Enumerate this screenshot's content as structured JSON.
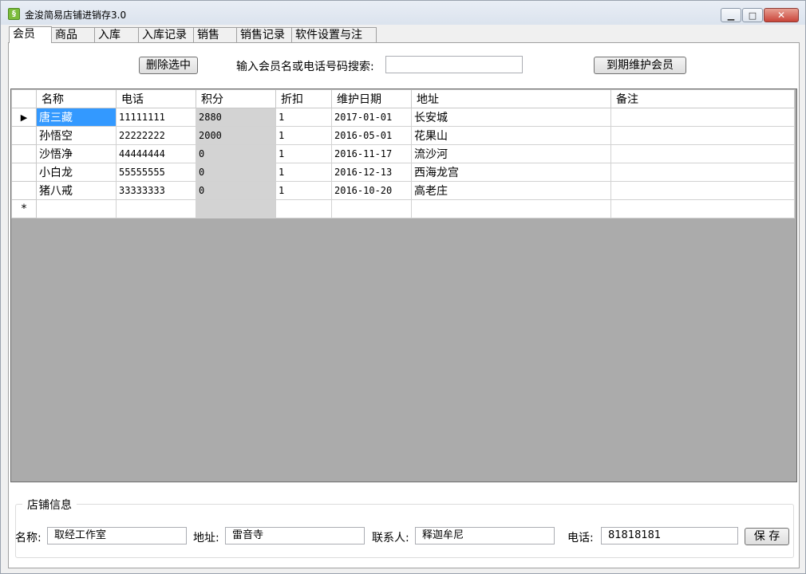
{
  "window": {
    "title": "金浚简易店铺进销存3.0",
    "controls": {
      "minimize": "▁",
      "maximize": "□",
      "close": "✕"
    }
  },
  "tabs": [
    "会员",
    "商品",
    "入库",
    "入库记录",
    "销售",
    "销售记录",
    "软件设置与注册"
  ],
  "toolbar": {
    "delete_label": "删除选中",
    "search_label": "输入会员名或电话号码搜索:",
    "search_value": "",
    "expire_label": "到期维护会员"
  },
  "grid": {
    "columns": [
      "名称",
      "电话",
      "积分",
      "折扣",
      "维护日期",
      "地址",
      "备注"
    ],
    "rows": [
      [
        "唐三藏",
        "11111111",
        "2880",
        "1",
        "2017-01-01",
        "长安城",
        ""
      ],
      [
        "孙悟空",
        "22222222",
        "2000",
        "1",
        "2016-05-01",
        "花果山",
        ""
      ],
      [
        "沙悟净",
        "44444444",
        "0",
        "1",
        "2016-11-17",
        "流沙河",
        ""
      ],
      [
        "小白龙",
        "55555555",
        "0",
        "1",
        "2016-12-13",
        "西海龙宫",
        ""
      ],
      [
        "猪八戒",
        "33333333",
        "0",
        "1",
        "2016-10-20",
        "高老庄",
        ""
      ]
    ],
    "current_row_marker": "▶",
    "new_row_marker": "*"
  },
  "shop_info": {
    "legend": "店铺信息",
    "name_label": "名称:",
    "name_value": "取经工作室",
    "address_label": "地址:",
    "address_value": "雷音寺",
    "contact_label": "联系人:",
    "contact_value": "释迦牟尼",
    "phone_label": "电话:",
    "phone_value": "81818181",
    "save_label": "保 存"
  },
  "colors": {
    "selection": "#3399ff",
    "grid_background": "#ababab",
    "points_column": "#d3d3d3"
  }
}
